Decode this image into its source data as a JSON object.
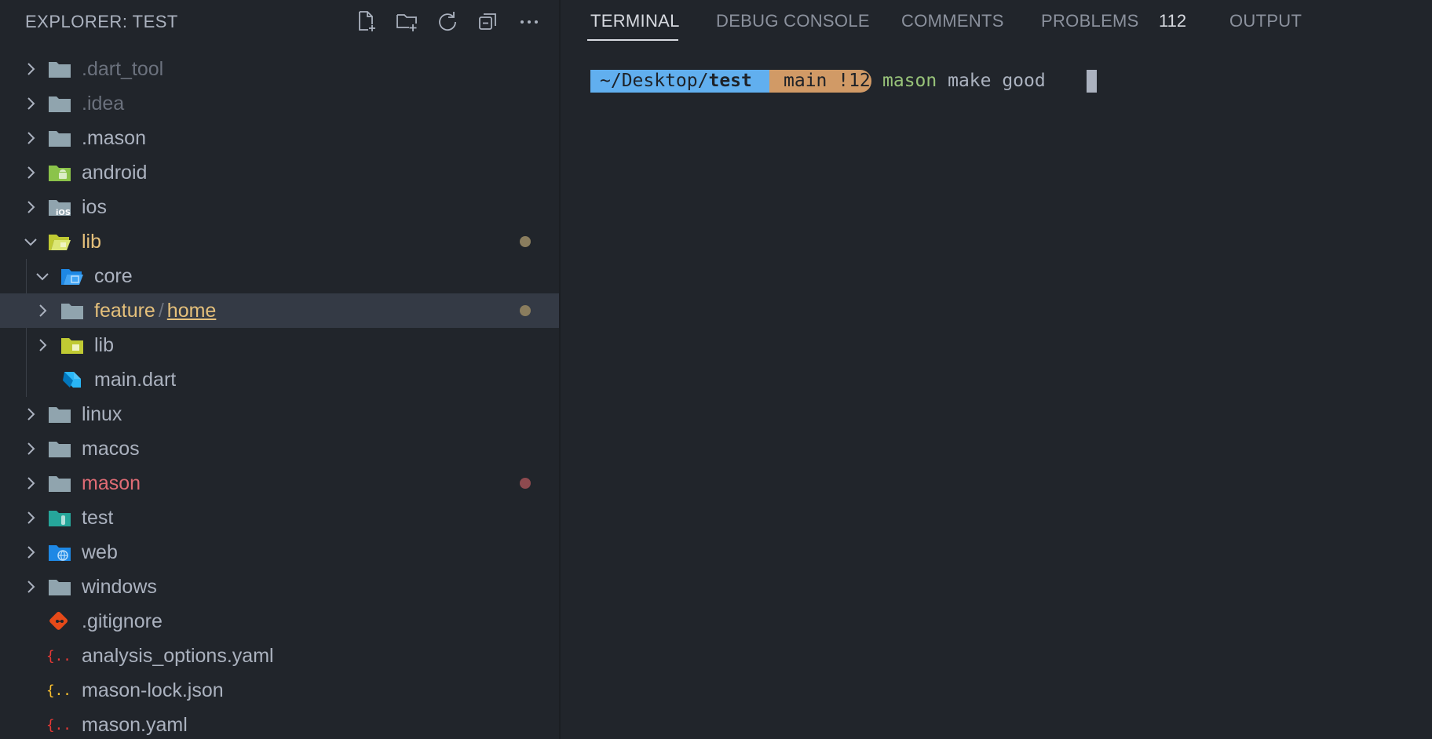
{
  "explorer": {
    "title": "EXPLORER: TEST",
    "actions": [
      {
        "icon": "new-file-icon"
      },
      {
        "icon": "new-folder-icon"
      },
      {
        "icon": "refresh-icon"
      },
      {
        "icon": "collapse-all-icon"
      },
      {
        "icon": "more-icon"
      }
    ],
    "items": [
      {
        "label": ".dart_tool",
        "type": "folder",
        "icon": "folder-icon",
        "expanded": false,
        "status": "ignored"
      },
      {
        "label": ".idea",
        "type": "folder",
        "icon": "folder-icon",
        "expanded": false,
        "status": "ignored"
      },
      {
        "label": ".mason",
        "type": "folder",
        "icon": "folder-icon",
        "expanded": false,
        "status": "normal"
      },
      {
        "label": "android",
        "type": "folder",
        "icon": "android-folder-icon",
        "expanded": false,
        "status": "normal"
      },
      {
        "label": "ios",
        "type": "folder",
        "icon": "ios-folder-icon",
        "expanded": false,
        "status": "normal"
      },
      {
        "label": "lib",
        "type": "folder",
        "icon": "lib-folder-open-icon",
        "expanded": true,
        "status": "modified"
      },
      {
        "label": "core",
        "type": "folder",
        "icon": "core-folder-open-icon",
        "expanded": true,
        "status": "normal"
      },
      {
        "label": "feature",
        "label2": "home",
        "type": "folder",
        "icon": "folder-icon",
        "expanded": false,
        "status": "modified",
        "selected": true
      },
      {
        "label": "lib",
        "type": "folder",
        "icon": "lib-folder-icon",
        "expanded": false,
        "status": "normal"
      },
      {
        "label": "main.dart",
        "type": "file",
        "icon": "dart-file-icon",
        "status": "normal"
      },
      {
        "label": "linux",
        "type": "folder",
        "icon": "folder-icon",
        "expanded": false,
        "status": "normal"
      },
      {
        "label": "macos",
        "type": "folder",
        "icon": "folder-icon",
        "expanded": false,
        "status": "normal"
      },
      {
        "label": "mason",
        "type": "folder",
        "icon": "folder-icon",
        "expanded": false,
        "status": "error"
      },
      {
        "label": "test",
        "type": "folder",
        "icon": "test-folder-icon",
        "expanded": false,
        "status": "normal"
      },
      {
        "label": "web",
        "type": "folder",
        "icon": "web-folder-icon",
        "expanded": false,
        "status": "normal"
      },
      {
        "label": "windows",
        "type": "folder",
        "icon": "folder-icon",
        "expanded": false,
        "status": "normal"
      },
      {
        "label": ".gitignore",
        "type": "file",
        "icon": "git-file-icon",
        "status": "normal"
      },
      {
        "label": "analysis_options.yaml",
        "type": "file",
        "icon": "yaml-file-icon",
        "status": "normal"
      },
      {
        "label": "mason-lock.json",
        "type": "file",
        "icon": "json-file-icon",
        "status": "normal"
      },
      {
        "label": "mason.yaml",
        "type": "file",
        "icon": "yaml-file-icon",
        "status": "normal"
      }
    ]
  },
  "panel": {
    "tabs": [
      {
        "label": "TERMINAL",
        "active": true
      },
      {
        "label": "DEBUG CONSOLE",
        "active": false
      },
      {
        "label": "COMMENTS",
        "active": false
      },
      {
        "label": "PROBLEMS",
        "active": false,
        "badge": "112"
      },
      {
        "label": "OUTPUT",
        "active": false
      }
    ],
    "terminal": {
      "path_prefix": "~/Desktop/",
      "path_dir": "test",
      "git": "main !12",
      "command": "mason",
      "args": " make good"
    }
  },
  "colors": {
    "background": "#21252b",
    "selected_row": "#343a45",
    "modified": "#e5c07b",
    "error": "#e06c75",
    "ignored": "#6b717d",
    "prompt_path": "#61afef",
    "prompt_git": "#d19a66",
    "command": "#98c379"
  }
}
